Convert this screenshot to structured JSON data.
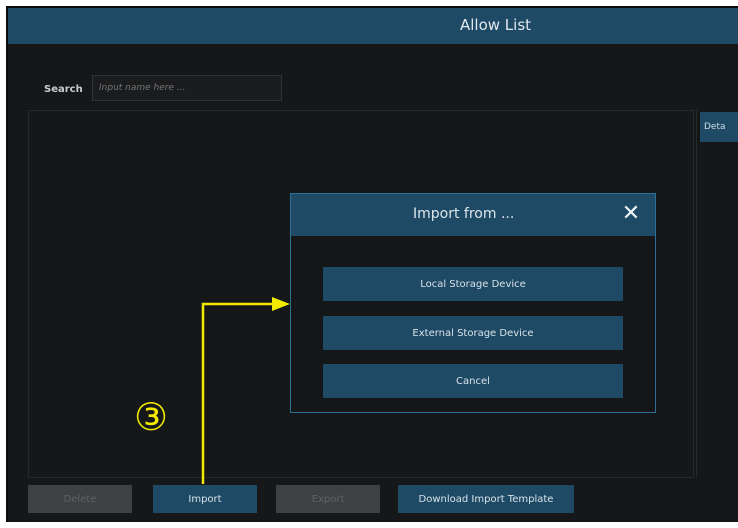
{
  "window": {
    "title": "Allow List"
  },
  "search": {
    "label": "Search",
    "placeholder": "Input name here ..."
  },
  "detail": {
    "tab_label": "Deta"
  },
  "dialog": {
    "title": "Import from ...",
    "close_glyph": "✕",
    "buttons": {
      "local": "Local Storage Device",
      "external": "External Storage Device",
      "cancel": "Cancel"
    }
  },
  "bottom_bar": {
    "delete": "Delete",
    "import": "Import",
    "export": "Export",
    "download_template": "Download Import Template"
  },
  "annotation": {
    "step": "③",
    "color": "#f2ea00"
  },
  "colors": {
    "accent": "#1f4a66",
    "background": "#161718",
    "dialog_border": "#2b6f93",
    "disabled_button": "#3e4144"
  }
}
